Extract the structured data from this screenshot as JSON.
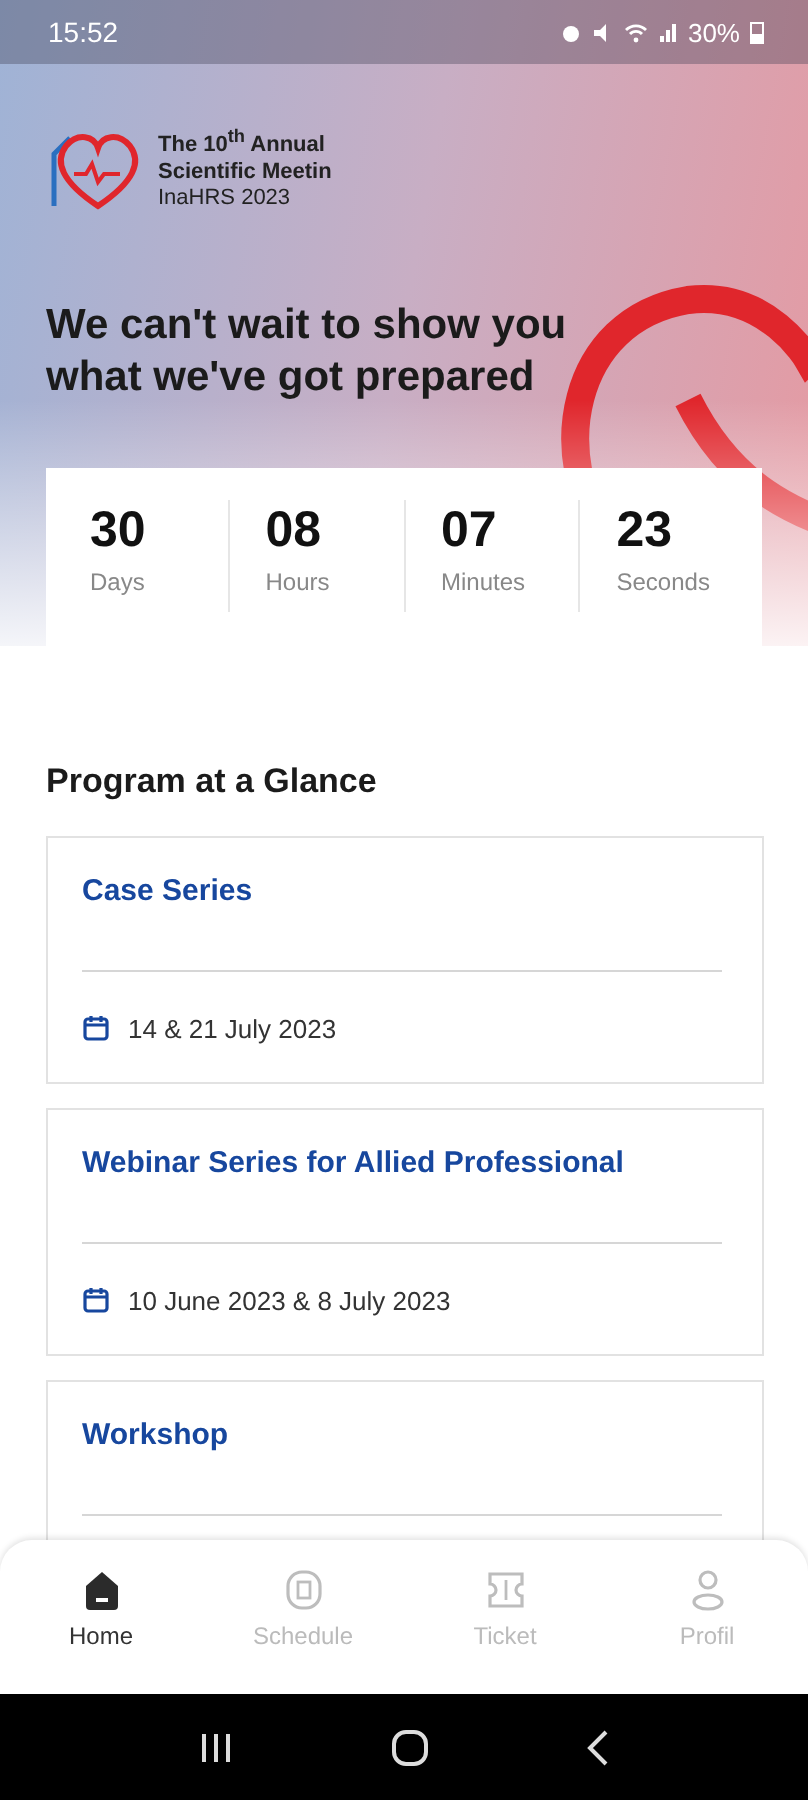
{
  "status_bar": {
    "time": "15:52",
    "battery": "30%"
  },
  "logo": {
    "lines": [
      "The 10$^{th}$ Annual",
      "Scientific Meetin",
      "InaHRS 2023"
    ]
  },
  "headline": "We can't wait to show you what we've got prepared",
  "countdown": [
    {
      "value": "30",
      "unit": "Days"
    },
    {
      "value": "08",
      "unit": "Hours"
    },
    {
      "value": "07",
      "unit": "Minutes"
    },
    {
      "value": "23",
      "unit": "Seconds"
    }
  ],
  "program": {
    "title": "Program at a Glance",
    "items": [
      {
        "title": "Case Series",
        "date": "14 & 21 July 2023"
      },
      {
        "title": "Webinar Series for Allied Professional",
        "date": "10 June 2023 & 8 July 2023"
      },
      {
        "title": "Workshop"
      }
    ]
  },
  "bottom_nav": [
    {
      "label": "Home",
      "selected": true
    },
    {
      "label": "Schedule",
      "selected": false
    },
    {
      "label": "Ticket",
      "selected": false
    },
    {
      "label": "Profil",
      "selected": false
    }
  ]
}
